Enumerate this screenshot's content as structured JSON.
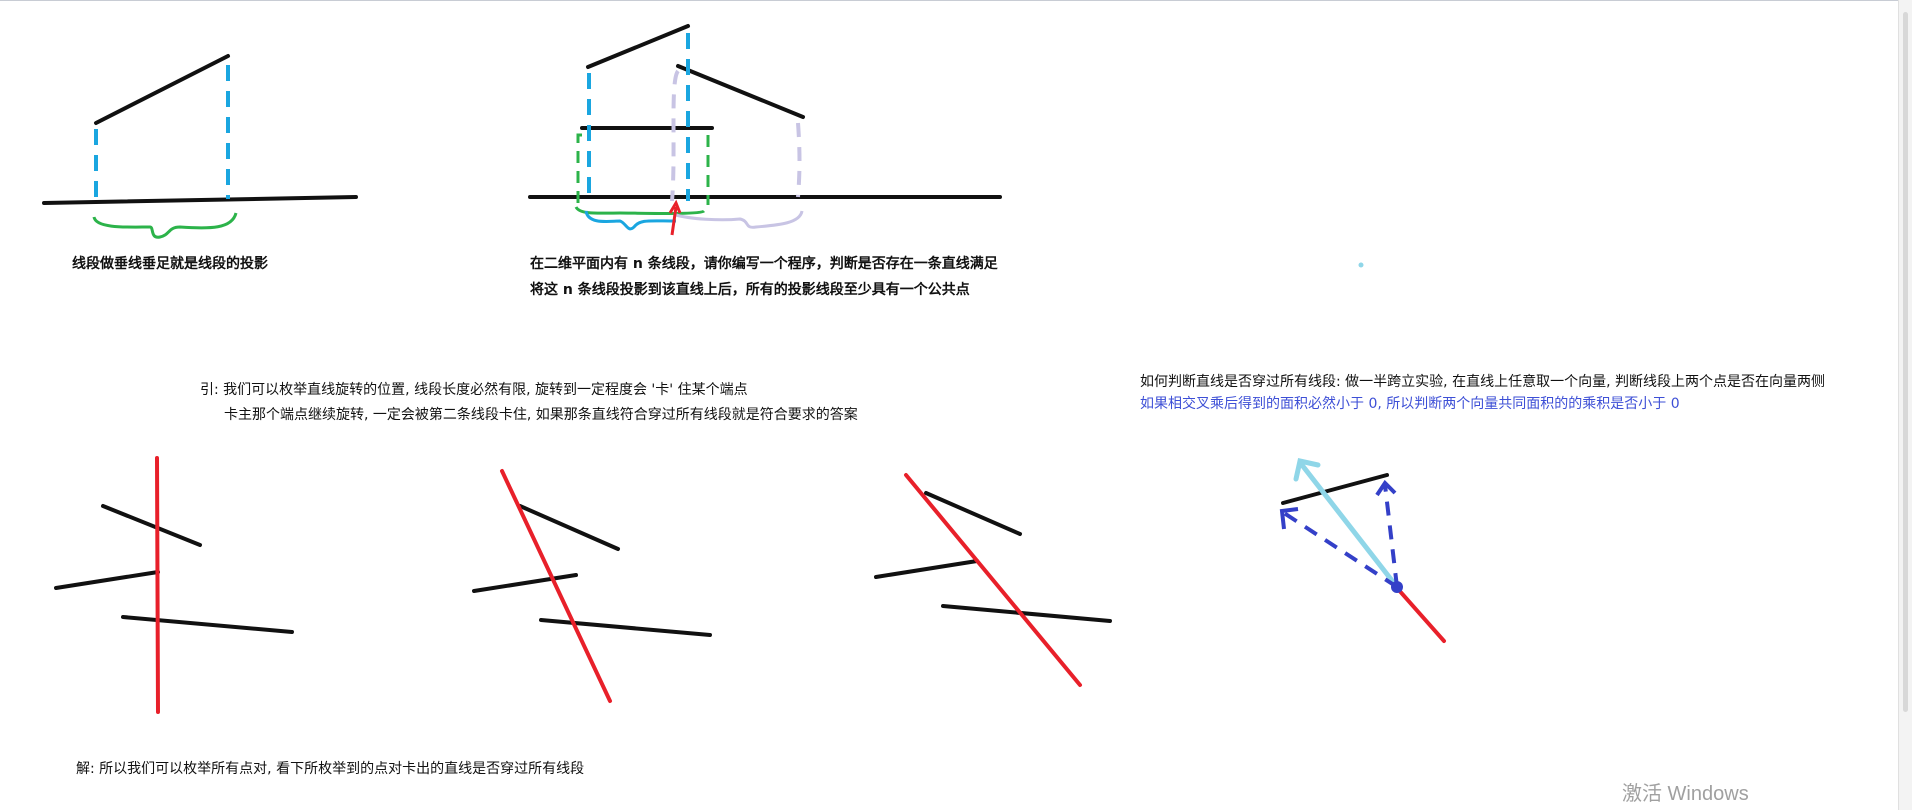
{
  "labels": {
    "projection_note": "线段做垂线垂足就是线段的投影",
    "problem_line1": "在二维平面内有 n 条线段，请你编写一个程序，判断是否存在一条直线满足",
    "problem_line2": "将这 n 条线段投影到该直线上后，所有的投影线段至少具有一个公共点",
    "intro_line1": "引: 我们可以枚举直线旋转的位置, 线段长度必然有限, 旋转到一定程度会 '卡' 住某个端点",
    "intro_line2": "卡主那个端点继续旋转, 一定会被第二条线段卡住, 如果那条直线符合穿过所有线段就是符合要求的答案",
    "judge_line1": "如何判断直线是否穿过所有线段: 做一半跨立实验, 在直线上任意取一个向量, 判断线段上两个点是否在向量两侧",
    "judge_line2": "如果相交叉乘后得到的面积必然小于 0, 所以判断两个向量共同面积的的乘积是否小于 0",
    "solution": "解: 所以我们可以枚举所有点对, 看下所枚举到的点对卡出的直线是否穿过所有线段"
  },
  "watermark": "激活 Windows",
  "colors": {
    "black": "#111111",
    "blue_dash": "#1aa6e0",
    "green": "#2cb34a",
    "lavender": "#c8c4e4",
    "red": "#e8202a",
    "indigo": "#3440c8",
    "light_cyan": "#8fd6e8",
    "text_blue": "#3d4fd6"
  }
}
